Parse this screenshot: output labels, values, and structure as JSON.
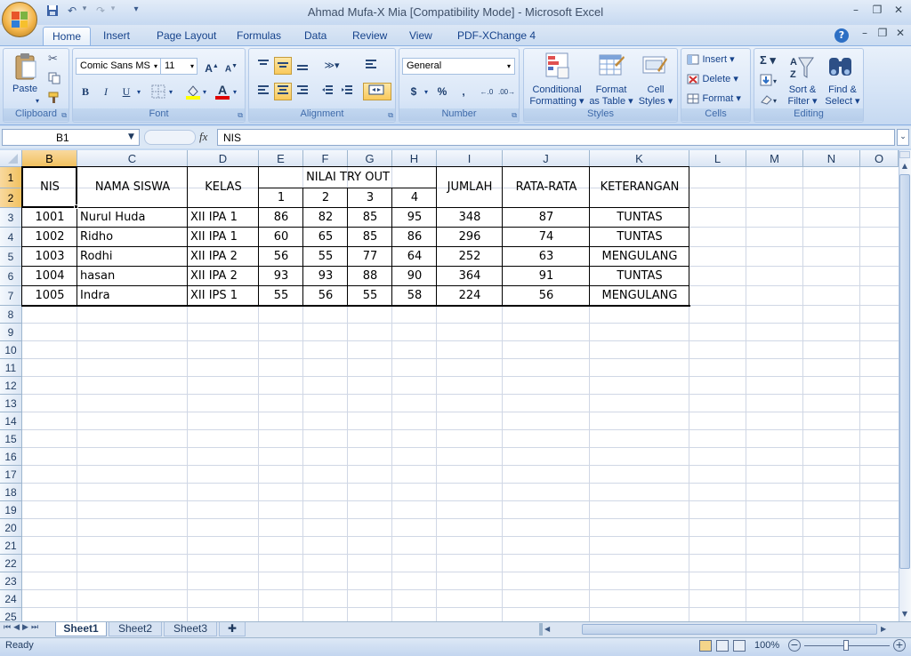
{
  "window": {
    "title": "Ahmad Mufa-X Mia  [Compatibility Mode] - Microsoft Excel",
    "min": "–",
    "max": "❐",
    "close": "✕"
  },
  "tabs": [
    "Home",
    "Insert",
    "Page Layout",
    "Formulas",
    "Data",
    "Review",
    "View",
    "PDF-XChange 4"
  ],
  "ribbon": {
    "clipboard": {
      "paste": "Paste",
      "label": "Clipboard"
    },
    "font": {
      "name": "Comic Sans MS",
      "size": "11",
      "bold": "B",
      "italic": "I",
      "underline": "U",
      "label": "Font"
    },
    "alignment": {
      "label": "Alignment"
    },
    "number": {
      "format": "General",
      "currency": "$",
      "percent": "%",
      "comma": ",",
      "label": "Number"
    },
    "styles": {
      "conditional": [
        "Conditional",
        "Formatting ▾"
      ],
      "as_table": [
        "Format",
        "as Table ▾"
      ],
      "cell_styles": [
        "Cell",
        "Styles ▾"
      ],
      "label": "Styles"
    },
    "cells": {
      "insert": "Insert ▾",
      "delete": "Delete ▾",
      "format": "Format ▾",
      "label": "Cells"
    },
    "editing": {
      "sigma": "Σ ▾",
      "sort": [
        "Sort &",
        "Filter ▾"
      ],
      "find": [
        "Find &",
        "Select ▾"
      ],
      "label": "Editing"
    }
  },
  "formula_bar": {
    "name_box": "B1",
    "fx": "fx",
    "content": "NIS"
  },
  "columns": [
    "B",
    "C",
    "D",
    "E",
    "F",
    "G",
    "H",
    "I",
    "J",
    "K",
    "L",
    "M",
    "N",
    "O"
  ],
  "rows": [
    "1",
    "2",
    "3",
    "4",
    "5",
    "6",
    "7",
    "8",
    "9",
    "10",
    "11",
    "12",
    "13",
    "14",
    "15",
    "16",
    "17",
    "18",
    "19",
    "20",
    "21",
    "22",
    "23",
    "24",
    "25"
  ],
  "table": {
    "headers": {
      "nis": "NIS",
      "nama": "NAMA SISWA",
      "kelas": "KELAS",
      "nilai": "NILAI TRY OUT",
      "n1": "1",
      "n2": "2",
      "n3": "3",
      "n4": "4",
      "jumlah": "JUMLAH",
      "rata": "RATA-RATA",
      "ket": "KETERANGAN"
    },
    "rows": [
      {
        "nis": "1001",
        "nama": " Nurul Huda",
        "kelas": "XII IPA 1",
        "n1": "86",
        "n2": "82",
        "n3": "85",
        "n4": "95",
        "jumlah": "348",
        "rata": "87",
        "ket": "TUNTAS"
      },
      {
        "nis": "1002",
        "nama": "Ridho",
        "kelas": "XII IPA 1",
        "n1": "60",
        "n2": "65",
        "n3": "85",
        "n4": "86",
        "jumlah": "296",
        "rata": "74",
        "ket": "TUNTAS"
      },
      {
        "nis": "1003",
        "nama": "Rodhi",
        "kelas": "XII IPA 2",
        "n1": "56",
        "n2": "55",
        "n3": "77",
        "n4": "64",
        "jumlah": "252",
        "rata": "63",
        "ket": "MENGULANG"
      },
      {
        "nis": "1004",
        "nama": "hasan",
        "kelas": "XII IPA 2",
        "n1": "93",
        "n2": "93",
        "n3": "88",
        "n4": "90",
        "jumlah": "364",
        "rata": "91",
        "ket": "TUNTAS"
      },
      {
        "nis": "1005",
        "nama": "Indra",
        "kelas": "XII IPS 1",
        "n1": "55",
        "n2": "56",
        "n3": "55",
        "n4": "58",
        "jumlah": "224",
        "rata": "56",
        "ket": "MENGULANG"
      }
    ]
  },
  "sheets": [
    "Sheet1",
    "Sheet2",
    "Sheet3"
  ],
  "status": {
    "ready": "Ready",
    "zoom": "100%"
  }
}
